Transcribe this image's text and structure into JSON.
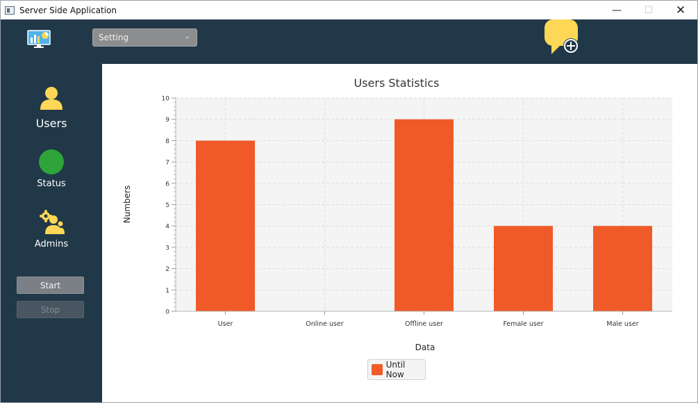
{
  "window": {
    "title": "Server Side Application",
    "controls": {
      "minimize": "—",
      "maximize": "☐",
      "close": "✕"
    }
  },
  "header": {
    "logo_icon": "dashboard-monitor-icon",
    "setting_select": {
      "selected": "Setting",
      "chevron": "⌄"
    },
    "chat_add_icon": "chat-bubble-add-icon",
    "colors": {
      "bg": "#213848",
      "accent": "#fdd755"
    }
  },
  "sidebar": {
    "items": [
      {
        "label": "Users",
        "icon": "user-icon"
      },
      {
        "label": "Status",
        "icon": "status-dot-icon",
        "color": "#2ea43a"
      },
      {
        "label": "Admins",
        "icon": "admins-gear-icon"
      }
    ],
    "buttons": {
      "start": "Start",
      "stop": "Stop"
    }
  },
  "chart_data": {
    "type": "bar",
    "title": "Users Statistics",
    "xlabel": "Data",
    "ylabel": "Numbers",
    "categories": [
      "User",
      "Online user",
      "Offline user",
      "Female user",
      "Male user"
    ],
    "series": [
      {
        "name": "Until Now",
        "values": [
          8,
          0,
          9,
          4,
          4
        ],
        "color": "#f05a28"
      }
    ],
    "ylim": [
      0,
      10
    ],
    "yticks": [
      0,
      1,
      2,
      3,
      4,
      5,
      6,
      7,
      8,
      9,
      10
    ],
    "grid": true,
    "legend": "bottom-center"
  }
}
